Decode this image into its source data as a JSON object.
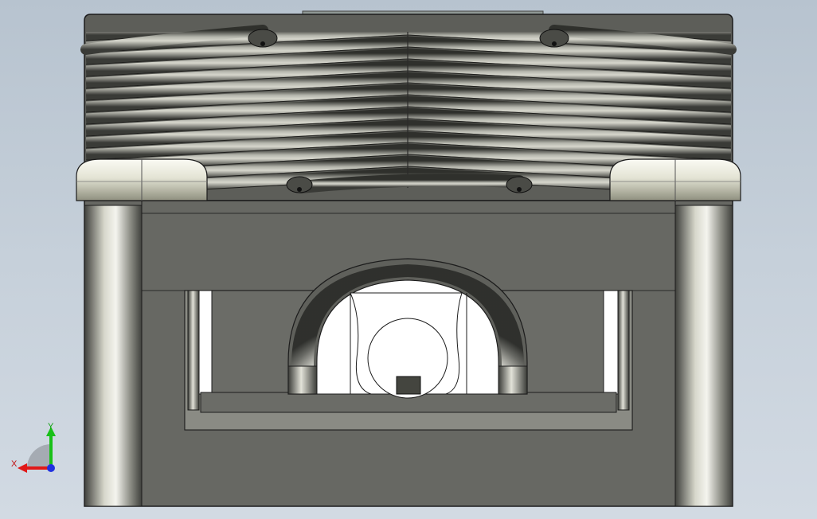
{
  "viewport": {
    "background_top": "#b7c3cf",
    "background_bottom": "#d2dae3",
    "view": "front"
  },
  "model": {
    "body_color": "#676863",
    "edge_color": "#1c1c1c",
    "cap_color": "#e9e9dc",
    "highlight_color": "#f4f4ee",
    "inner_color": "#ffffff"
  },
  "triad": {
    "x_label": "X",
    "y_label": "Y",
    "x_color": "#e01818",
    "y_color": "#18c018",
    "z_color": "#2030e0"
  }
}
